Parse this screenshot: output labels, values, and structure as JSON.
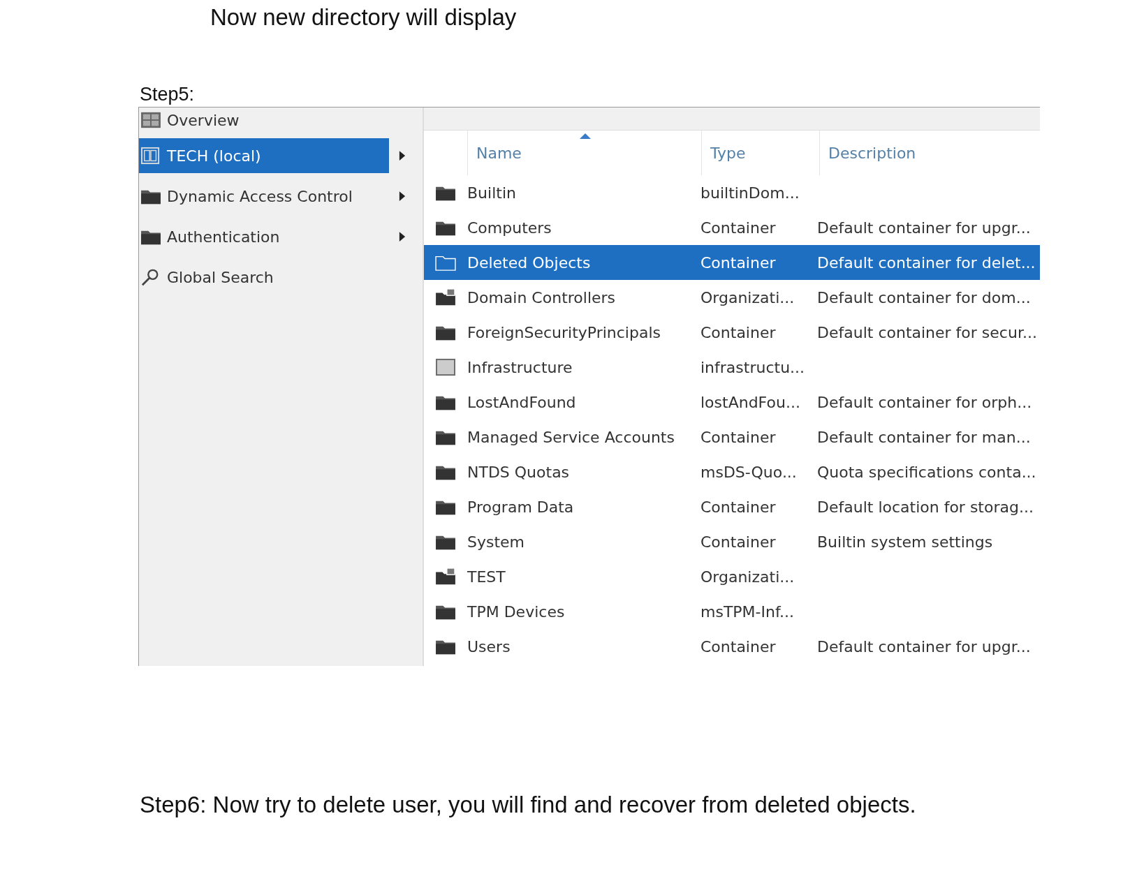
{
  "heading": "Now new directory will display",
  "step5_label": "Step5:",
  "console": {
    "sidebar": {
      "items": [
        {
          "label": "Overview",
          "kind": "overview",
          "selected": false,
          "has_arrow": false
        },
        {
          "label": "TECH (local)",
          "kind": "domain",
          "selected": true,
          "has_arrow": true
        },
        {
          "label": "Dynamic Access Control",
          "kind": "folder",
          "selected": false,
          "has_arrow": true
        },
        {
          "label": "Authentication",
          "kind": "folder",
          "selected": false,
          "has_arrow": true
        },
        {
          "label": "Global Search",
          "kind": "search",
          "selected": false,
          "has_arrow": false
        }
      ]
    },
    "table": {
      "columns": [
        {
          "label": "Name",
          "sorted": true
        },
        {
          "label": "Type",
          "sorted": false
        },
        {
          "label": "Description",
          "sorted": false
        }
      ],
      "rows": [
        {
          "kind": "folder",
          "name": "Builtin",
          "type": "builtinDom...",
          "description": "",
          "selected": false
        },
        {
          "kind": "folder",
          "name": "Computers",
          "type": "Container",
          "description": "Default container for upgr...",
          "selected": false
        },
        {
          "kind": "folder",
          "name": "Deleted Objects",
          "type": "Container",
          "description": "Default container for delet...",
          "selected": true
        },
        {
          "kind": "ou",
          "name": "Domain Controllers",
          "type": "Organizati...",
          "description": "Default container for dom...",
          "selected": false
        },
        {
          "kind": "folder",
          "name": "ForeignSecurityPrincipals",
          "type": "Container",
          "description": "Default container for secur...",
          "selected": false
        },
        {
          "kind": "square",
          "name": "Infrastructure",
          "type": "infrastructu...",
          "description": "",
          "selected": false
        },
        {
          "kind": "folder",
          "name": "LostAndFound",
          "type": "lostAndFou...",
          "description": "Default container for orph...",
          "selected": false
        },
        {
          "kind": "folder",
          "name": "Managed Service Accounts",
          "type": "Container",
          "description": "Default container for man...",
          "selected": false
        },
        {
          "kind": "folder",
          "name": "NTDS Quotas",
          "type": "msDS-Quo...",
          "description": "Quota specifications conta...",
          "selected": false
        },
        {
          "kind": "folder",
          "name": "Program Data",
          "type": "Container",
          "description": "Default location for storag...",
          "selected": false
        },
        {
          "kind": "folder",
          "name": "System",
          "type": "Container",
          "description": "Builtin system settings",
          "selected": false
        },
        {
          "kind": "ou",
          "name": "TEST",
          "type": "Organizati...",
          "description": "",
          "selected": false
        },
        {
          "kind": "folder",
          "name": "TPM Devices",
          "type": "msTPM-Inf...",
          "description": "",
          "selected": false
        },
        {
          "kind": "folder",
          "name": "Users",
          "type": "Container",
          "description": "Default container for upgr...",
          "selected": false
        }
      ]
    }
  },
  "step6": "Step6: Now try to delete user, you will find and recover from deleted objects."
}
